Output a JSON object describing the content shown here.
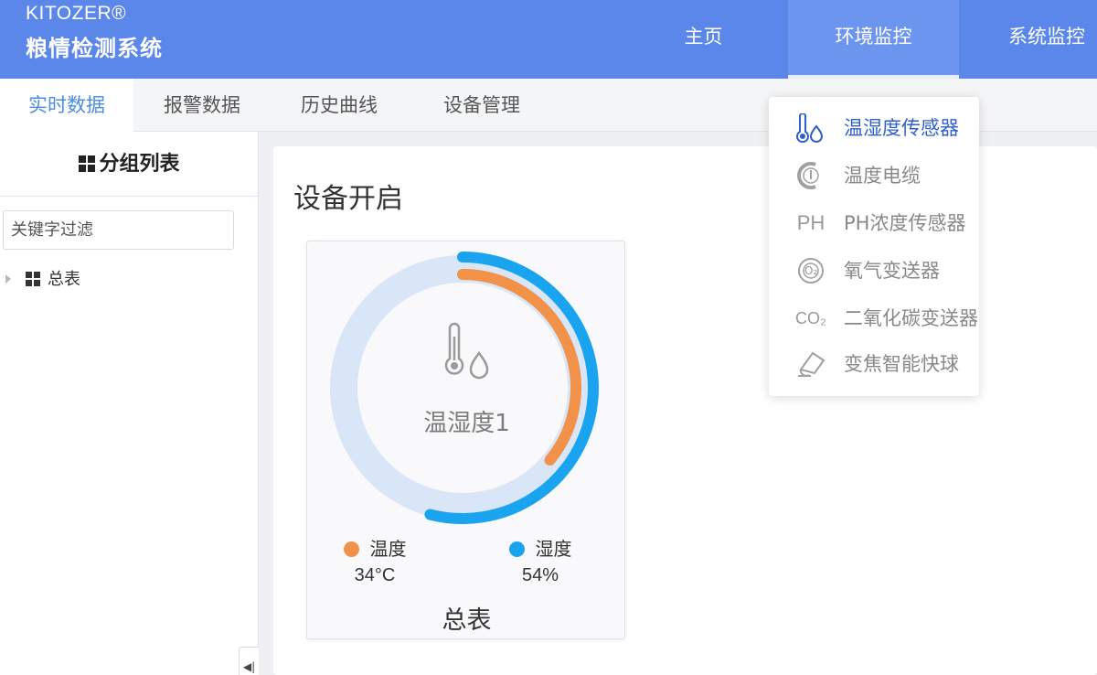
{
  "header": {
    "brand_name": "KITOZER®",
    "system_name": "粮情检测系统",
    "nav": [
      {
        "label": "主页"
      },
      {
        "label": "环境监控",
        "active": true
      },
      {
        "label": "系统监控"
      }
    ]
  },
  "tabs": [
    {
      "label": "实时数据",
      "active": true
    },
    {
      "label": "报警数据"
    },
    {
      "label": "历史曲线"
    },
    {
      "label": "设备管理"
    }
  ],
  "sidebar": {
    "title": "分组列表",
    "filter_placeholder": "关键字过滤",
    "tree": [
      {
        "label": "总表"
      }
    ]
  },
  "main": {
    "title": "设备开启",
    "card": {
      "name": "温湿度1",
      "temperature": {
        "label": "温度",
        "value": "34°C",
        "numeric": 34,
        "fraction": 0.36,
        "color": "#f29149"
      },
      "humidity": {
        "label": "湿度",
        "value": "54%",
        "numeric": 54,
        "fraction": 0.54,
        "color": "#1aa4f0"
      },
      "ring_track_color": "#d8e6f8",
      "footer": "总表"
    }
  },
  "dropdown": {
    "items": [
      {
        "label": "温湿度传感器",
        "icon": "thermo-drop-icon",
        "active": true
      },
      {
        "label": "温度电缆",
        "icon": "cable-temp-icon"
      },
      {
        "label": "PH浓度传感器",
        "icon": "ph-icon",
        "icon_text": "PH"
      },
      {
        "label": "氧气变送器",
        "icon": "oxygen-icon",
        "icon_text": "O₂"
      },
      {
        "label": "二氧化碳变送器",
        "icon": "co2-icon",
        "icon_text": "CO₂"
      },
      {
        "label": "变焦智能快球",
        "icon": "camera-dome-icon"
      }
    ]
  },
  "colors": {
    "header_bg": "#5b87ea",
    "active_tab_text": "#4b8ce0",
    "active_menu_text": "#2f5fcf"
  }
}
